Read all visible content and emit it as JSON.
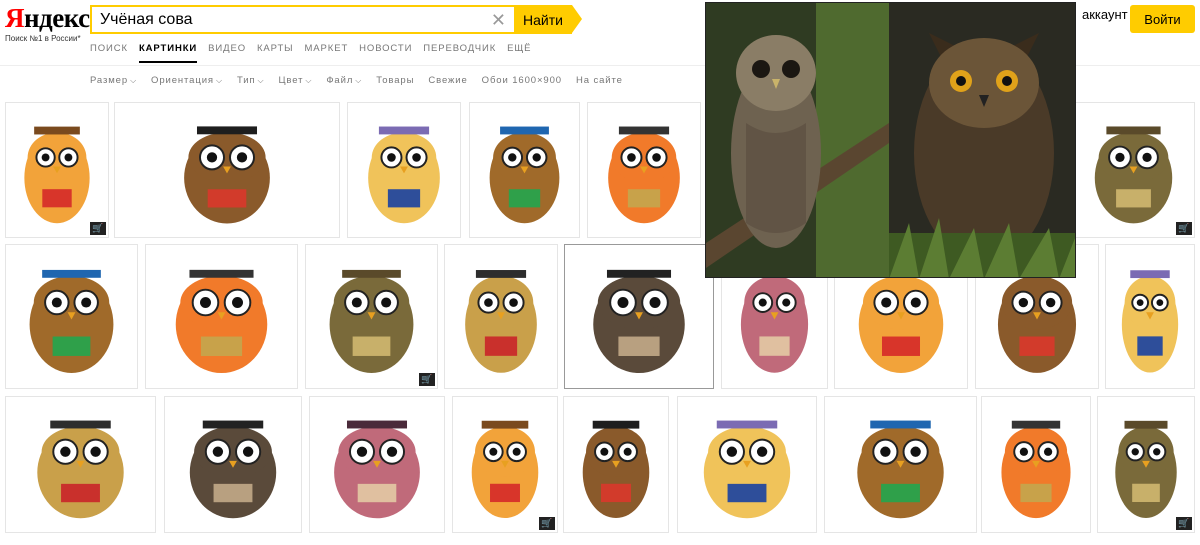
{
  "logo": {
    "word_ya": "Я",
    "word_rest": "ндекс",
    "tagline": "Поиск №1 в России*"
  },
  "search": {
    "value": "Учёная сова",
    "placeholder": "",
    "button_label": "Найти"
  },
  "nav": {
    "items": [
      "Поиск",
      "Картинки",
      "Видео",
      "Карты",
      "Маркет",
      "Новости",
      "Переводчик",
      "Ещё"
    ],
    "active_index": 1
  },
  "header": {
    "login_link": "аккаунт",
    "login_button": "Войти"
  },
  "filters": {
    "items": [
      {
        "label": "Размер",
        "has_caret": true
      },
      {
        "label": "Ориентация",
        "has_caret": true
      },
      {
        "label": "Тип",
        "has_caret": true
      },
      {
        "label": "Цвет",
        "has_caret": true
      },
      {
        "label": "Файл",
        "has_caret": true
      },
      {
        "label": "Товары",
        "has_caret": false
      },
      {
        "label": "Свежие",
        "has_caret": false
      },
      {
        "label": "Обои 1600×900",
        "has_caret": false
      },
      {
        "label": "На сайте",
        "has_caret": false
      }
    ]
  },
  "colors": {
    "accent": "#ffcc00",
    "logo_red": "#ff0000",
    "nav_muted": "#777777"
  },
  "icons": {
    "cart": "shopping-cart-icon",
    "clear": "close-icon",
    "caret": "chevron-down-icon"
  },
  "results": {
    "row1": [
      {
        "name": "owl-book-glasses",
        "cart": true
      },
      {
        "name": "owl-pointer-cap",
        "cart": false
      },
      {
        "name": "owl-pencil-suit",
        "cart": false
      },
      {
        "name": "owl-on-books",
        "cart": false
      },
      {
        "name": "owl-orange-book",
        "cart": false
      },
      {
        "name": "owl-bronze-figure",
        "cart": true
      }
    ],
    "row2": [
      {
        "name": "owl-apple-books",
        "cart": false
      },
      {
        "name": "owl-realistic-cap",
        "cart": false
      },
      {
        "name": "owl-thin-legs",
        "cart": true
      },
      {
        "name": "owl-yellow-reading",
        "cart": false
      },
      {
        "name": "owl-pointer-books",
        "cart": false
      },
      {
        "name": "owl-branch-book",
        "cart": false
      },
      {
        "name": "owl-book-red",
        "cart": false
      },
      {
        "name": "owl-brown-glasses",
        "cart": false
      },
      {
        "name": "owl-dark-cap",
        "cart": false
      }
    ],
    "row3": [
      {
        "name": "owl-waving",
        "cart": false
      },
      {
        "name": "owl-branch-sketch",
        "cart": false
      },
      {
        "name": "owl-tie-stick",
        "cart": false
      },
      {
        "name": "owl-bronze-books",
        "cart": true
      },
      {
        "name": "owl-gold-figure",
        "cart": false
      },
      {
        "name": "owl-orange-cap",
        "cart": false
      },
      {
        "name": "owl-pair-small",
        "cart": false
      },
      {
        "name": "owl-dark-photo",
        "cart": false
      },
      {
        "name": "owl-book-glasses-2",
        "cart": true
      }
    ]
  },
  "preview": {
    "left": "owl-photo-barred",
    "right": "owl-photo-horned"
  }
}
